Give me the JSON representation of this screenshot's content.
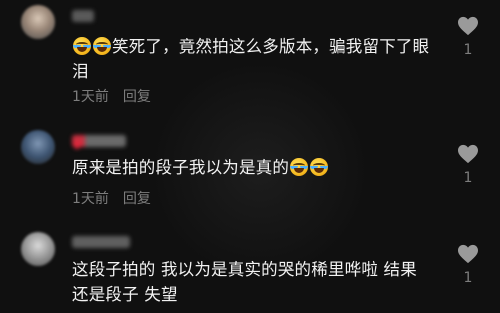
{
  "comments": [
    {
      "text_before": "",
      "emoji_lead": [
        "laughing-crying-emoji",
        "laughing-crying-emoji"
      ],
      "text": "笑死了，竟然拍这么多版本，骗我留下了眼泪",
      "emoji_tail": [],
      "time": "1天前",
      "reply": "回复",
      "likes": "1"
    },
    {
      "text": "原来是拍的段子我以为是真的",
      "emoji_lead": [],
      "emoji_tail": [
        "laughing-crying-emoji",
        "laughing-crying-emoji"
      ],
      "time": "1天前",
      "reply": "回复",
      "likes": "1"
    },
    {
      "text": "这段子拍的 我以为是真实的哭的稀里哗啦 结果还是段子 失望",
      "emoji_lead": [],
      "emoji_tail": [],
      "time": "",
      "reply": "",
      "likes": "1"
    }
  ],
  "colors": {
    "background": "#101010",
    "text": "#f2f2f2",
    "meta": "#7d7d7d",
    "heart": "#9a9a9a"
  },
  "icons": {
    "like": "heart-outline-icon",
    "badge": "red-heart-icon"
  }
}
